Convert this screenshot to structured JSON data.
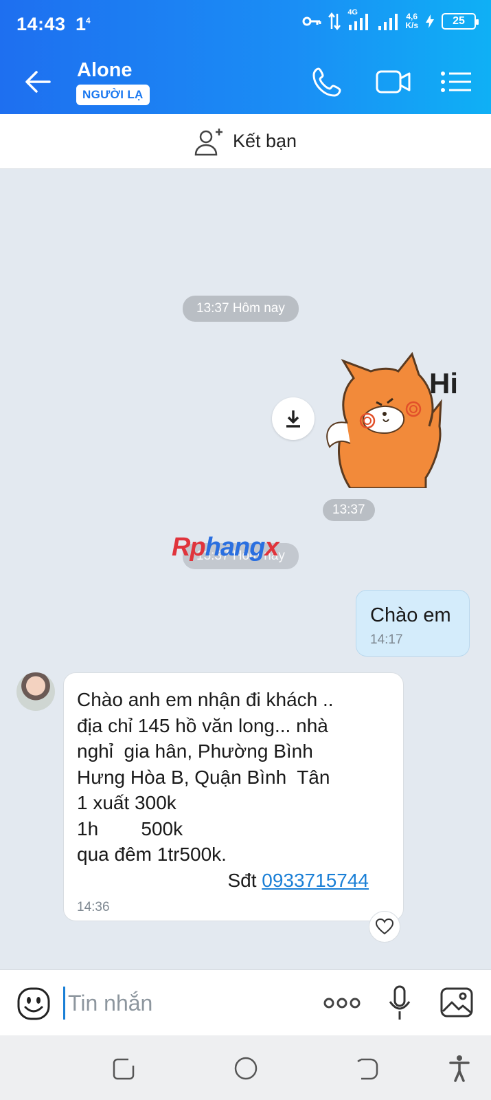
{
  "status": {
    "time": "14:43",
    "sim": "1",
    "sim_sup": "4",
    "net": "4G",
    "speed_top": "4,6",
    "speed_bottom": "K/s",
    "battery": "25"
  },
  "header": {
    "title": "Alone",
    "badge": "NGƯỜI LẠ"
  },
  "add_friend": {
    "label": "Kết bạn"
  },
  "messages": {
    "time_pill_1": "13:37 Hôm nay",
    "sticker_text": "Hi",
    "sticker_time": "13:37",
    "time_pill_2": "13:37 Hôm nay",
    "outgoing": {
      "text": "Chào em",
      "time": "14:17"
    },
    "incoming": {
      "lines": [
        "Chào anh em nhận đi khách ..",
        "địa chỉ 145 hồ văn long... nhà",
        "nghỉ  gia hân, Phường Bình",
        "Hưng Hòa B, Quận Bình  Tân",
        "1 xuất 300k",
        "1h        500k",
        "qua đêm 1tr500k."
      ],
      "phone_prefix": "Sđt ",
      "phone": "0933715744",
      "time": "14:36"
    }
  },
  "watermark": {
    "part1": "Rp",
    "part2": "hang",
    "part3": "x"
  },
  "input": {
    "placeholder": "Tin nhắn"
  },
  "colors": {
    "header_start": "#1e6ff0",
    "header_end": "#0fb0f5",
    "link": "#1a7fd6",
    "outgoing_bubble": "#d4ecfb",
    "chat_bg": "#e3e9f0"
  }
}
